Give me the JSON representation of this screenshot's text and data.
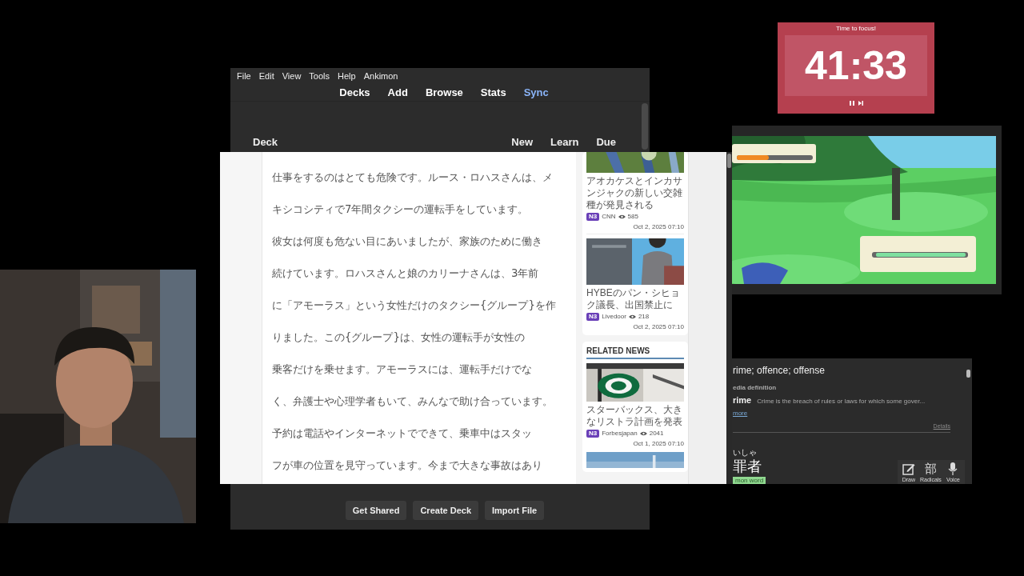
{
  "anki": {
    "menu": [
      "File",
      "Edit",
      "View",
      "Tools",
      "Help",
      "Ankimon"
    ],
    "nav": [
      {
        "label": "Decks",
        "color": "#ffffff"
      },
      {
        "label": "Add",
        "color": "#ffffff"
      },
      {
        "label": "Browse",
        "color": "#ffffff"
      },
      {
        "label": "Stats",
        "color": "#ffffff"
      },
      {
        "label": "Sync",
        "color": "#8ab4f8"
      }
    ],
    "columns": [
      "Deck",
      "New",
      "Learn",
      "Due"
    ],
    "buttons": [
      "Get Shared",
      "Create Deck",
      "Import File"
    ]
  },
  "article": {
    "lines": [
      "仕事をするのはとても危険です。ルース・ロハスさんは、メ",
      "キシコシティで7年間タクシーの運転手をしています。",
      "彼女は何度も危ない目にあいましたが、家族のために働き",
      "続けています。ロハスさんと娘のカリーナさんは、3年前",
      "に「アモーラス」という女性だけのタクシー{グループ}を作",
      "りました。この{グループ}は、女性の運転手が女性の",
      "乗客だけを乗せます。アモーラスには、運転手だけでな",
      "く、弁護士や心理学者もいて、みんなで助け合っています。",
      "予約は電話やインターネットでできて、乗車中はスタッ",
      "フが車の位置を見守っています。今まで大きな事故はあり"
    ]
  },
  "news": {
    "cards": [
      {
        "title": "アオカケスとインカサンジャクの新しい交雑種が発見される",
        "level": "N3",
        "source": "CNN",
        "views": "585",
        "date": "Oct 2, 2025 07:10"
      },
      {
        "title": "HYBEのパン・シヒョク議長、出国禁止に",
        "level": "N3",
        "source": "Livedoor",
        "views": "218",
        "date": "Oct 2, 2025 07:10"
      }
    ],
    "related": {
      "heading": "RELATED NEWS",
      "cards": [
        {
          "title": "スターバックス、大きなリストラ計画を発表",
          "level": "N3",
          "source": "Forbesjapan",
          "views": "2041",
          "date": "Oct 1, 2025 07:10"
        }
      ]
    }
  },
  "timer": {
    "title": "Time to focus!",
    "time": "41:33"
  },
  "dictionary": {
    "meaning": "rime; offence; offense",
    "section": "edia definition",
    "term": "rime",
    "definition": "Crime is the breach of rules or laws for which some gover...",
    "link": "more",
    "details": "Details",
    "reading": "いしゃ",
    "word": "罪者",
    "tag": "mon word",
    "tools": [
      {
        "kind": "draw",
        "label": "Draw"
      },
      {
        "kind": "glyph",
        "glyph": "部",
        "label": "Radicals"
      },
      {
        "kind": "voice",
        "label": "Voice"
      }
    ]
  }
}
